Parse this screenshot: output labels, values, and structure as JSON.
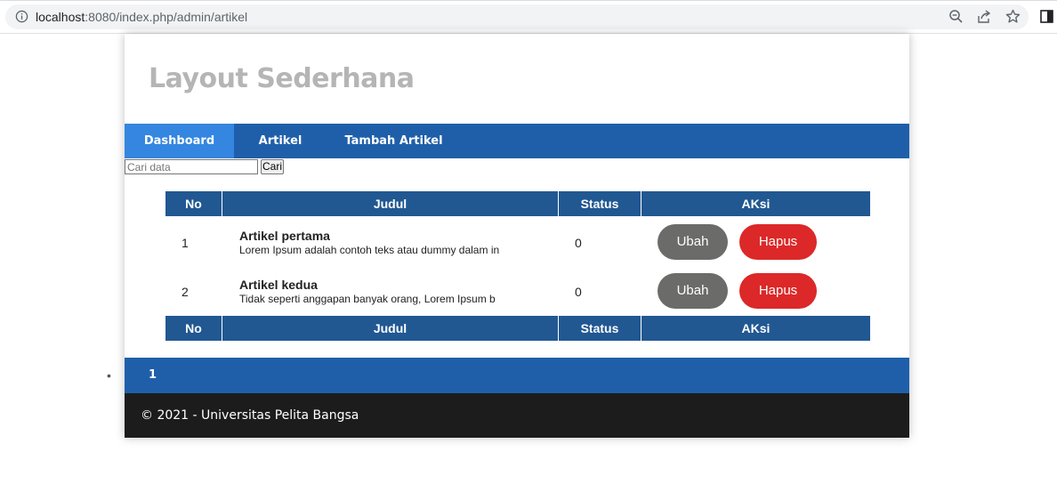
{
  "browser": {
    "url_host": "localhost",
    "url_rest": ":8080/index.php/admin/artikel",
    "icons": [
      "info-icon",
      "zoom-icon",
      "share-icon",
      "star-icon",
      "sidepanel-icon"
    ]
  },
  "site": {
    "title": "Layout Sederhana"
  },
  "nav": {
    "items": [
      {
        "label": "Dashboard",
        "active": true
      },
      {
        "label": "Artikel",
        "active": false
      },
      {
        "label": "Tambah Artikel",
        "active": false
      }
    ]
  },
  "search": {
    "placeholder": "Cari data",
    "value": "",
    "button_label": "Cari"
  },
  "table": {
    "headers": [
      "No",
      "Judul",
      "Status",
      "AKsi"
    ],
    "rows": [
      {
        "no": "1",
        "title": "Artikel pertama",
        "excerpt": "Lorem Ipsum adalah contoh teks atau dummy dalam in",
        "status": "0",
        "edit_label": "Ubah",
        "delete_label": "Hapus"
      },
      {
        "no": "2",
        "title": "Artikel kedua",
        "excerpt": "Tidak seperti anggapan banyak orang, Lorem Ipsum b",
        "status": "0",
        "edit_label": "Ubah",
        "delete_label": "Hapus"
      }
    ]
  },
  "pagination": {
    "pages": [
      "1"
    ]
  },
  "footer": {
    "text": "© 2021 - Universitas Pelita Bangsa"
  },
  "colors": {
    "nav_bg": "#1f5faa",
    "nav_active": "#3486e0",
    "table_head": "#215892",
    "button_edit": "#6b6b69",
    "button_delete": "#dc2828",
    "footer_bg": "#1c1c1c",
    "title_color": "#b5b5b5"
  }
}
